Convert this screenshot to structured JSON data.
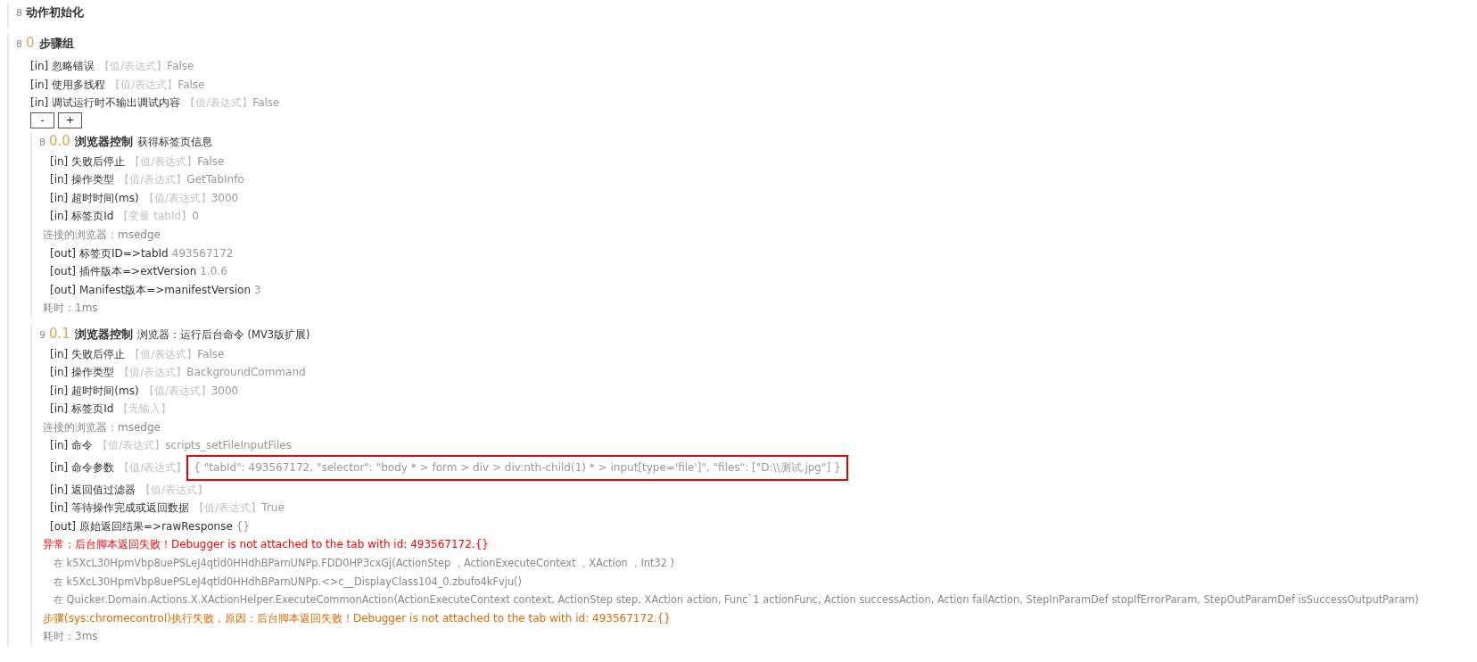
{
  "header": {
    "count": "8",
    "title": "动作初始化"
  },
  "group": {
    "count": "8",
    "index": "0",
    "title": "步骤组",
    "params": [
      {
        "dir": "[in]",
        "name": "忽略错误",
        "source": "【值/表达式】",
        "value": "False"
      },
      {
        "dir": "[in]",
        "name": "使用多线程",
        "source": "【值/表达式】",
        "value": "False"
      },
      {
        "dir": "[in]",
        "name": "调试运行时不输出调试内容",
        "source": "【值/表达式】",
        "value": "False"
      }
    ],
    "buttons": [
      "-",
      "+"
    ],
    "steps": [
      {
        "count": "8",
        "index": "0.0",
        "title": "浏览器控制",
        "subtitle": "获得标签页信息",
        "lines": [
          {
            "kind": "param",
            "dir": "[in]",
            "name": "失败后停止",
            "source": "【值/表达式】",
            "value": "False"
          },
          {
            "kind": "param",
            "dir": "[in]",
            "name": "操作类型",
            "source": "【值/表达式】",
            "value": "GetTabInfo"
          },
          {
            "kind": "param",
            "dir": "[in]",
            "name": "超时时间(ms)",
            "source": "【值/表达式】",
            "value": "3000"
          },
          {
            "kind": "param",
            "dir": "[in]",
            "name": "标签页Id",
            "source": "【变量 tabId】",
            "value": "0"
          },
          {
            "kind": "info",
            "text": "连接的浏览器：msedge"
          },
          {
            "kind": "param",
            "dir": "[out]",
            "name": "标签页ID=>tabId",
            "value": "493567172"
          },
          {
            "kind": "param",
            "dir": "[out]",
            "name": "插件版本=>extVersion",
            "value": "1.0.6"
          },
          {
            "kind": "param",
            "dir": "[out]",
            "name": "Manifest版本=>manifestVersion",
            "value": "3"
          },
          {
            "kind": "duration",
            "text": "耗时：1ms"
          }
        ]
      },
      {
        "count": "9",
        "index": "0.1",
        "title": "浏览器控制",
        "subtitle": "浏览器：运行后台命令 (MV3版扩展)",
        "lines": [
          {
            "kind": "param",
            "dir": "[in]",
            "name": "失败后停止",
            "source": "【值/表达式】",
            "value": "False"
          },
          {
            "kind": "param",
            "dir": "[in]",
            "name": "操作类型",
            "source": "【值/表达式】",
            "value": "BackgroundCommand"
          },
          {
            "kind": "param",
            "dir": "[in]",
            "name": "超时时间(ms)",
            "source": "【值/表达式】",
            "value": "3000"
          },
          {
            "kind": "param",
            "dir": "[in]",
            "name": "标签页Id",
            "source": "【无输入】"
          },
          {
            "kind": "info",
            "text": "连接的浏览器：msedge"
          },
          {
            "kind": "param",
            "dir": "[in]",
            "name": "命令",
            "source": "【值/表达式】",
            "value": "scripts_setFileInputFiles"
          },
          {
            "kind": "param",
            "dir": "[in]",
            "name": "命令参数",
            "source": "【值/表达式】",
            "value": "{ \"tabId\": 493567172, \"selector\": \"body * > form > div > div:nth-child(1) * > input[type='file']\", \"files\": [\"D:\\\\测试.jpg\"] }",
            "highlighted": true
          },
          {
            "kind": "param",
            "dir": "[in]",
            "name": "返回值过滤器",
            "source": "【值/表达式】"
          },
          {
            "kind": "param",
            "dir": "[in]",
            "name": "等待操作完成或返回数据",
            "source": "【值/表达式】",
            "value": "True"
          },
          {
            "kind": "param",
            "dir": "[out]",
            "name": "原始返回结果=>rawResponse",
            "value": "{}"
          },
          {
            "kind": "error",
            "text": "异常：后台脚本返回失败！Debugger is not attached to the tab with id: 493567172.{}"
          },
          {
            "kind": "trace",
            "text": "在 k5XcL30HpmVbp8uePSLeJ4qtld0HHdhBParnUNPp.FDD0HP3cxGj(ActionStep ，ActionExecuteContext ，XAction ，Int32 )"
          },
          {
            "kind": "trace",
            "text": "在 k5XcL30HpmVbp8uePSLeJ4qtld0HHdhBParnUNPp.<>c__DisplayClass104_0.zbufo4kFvju()"
          },
          {
            "kind": "trace",
            "text": "在 Quicker.Domain.Actions.X.XActionHelper.ExecuteCommonAction(ActionExecuteContext context, ActionStep step, XAction action, Func`1 actionFunc, Action successAction, Action failAction, StepInParamDef stopIfErrorParam, StepOutParamDef isSuccessOutputParam)"
          },
          {
            "kind": "failure",
            "text": "步骤(sys:chromecontrol)执行失败，原因：后台脚本返回失败！Debugger is not attached to the tab with id: 493567172.{}"
          },
          {
            "kind": "duration",
            "text": "耗时：3ms"
          }
        ]
      }
    ]
  }
}
